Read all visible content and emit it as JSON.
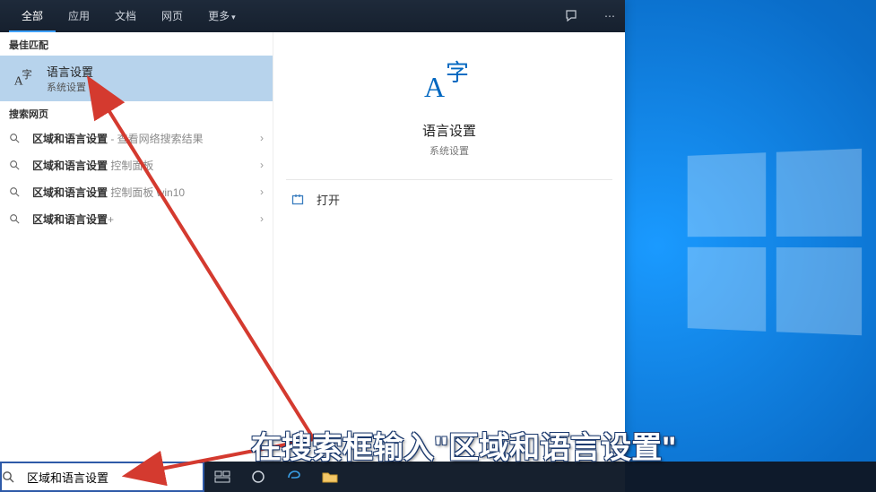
{
  "tabs": {
    "all": "全部",
    "apps": "应用",
    "docs": "文档",
    "web": "网页",
    "more": "更多"
  },
  "sections": {
    "best_match": "最佳匹配",
    "web_search": "搜索网页"
  },
  "best_match": {
    "title": "语言设置",
    "subtitle": "系统设置"
  },
  "web_results": [
    {
      "prefix": "区域和语言设置",
      "suffix": " - 查看网络搜索结果",
      "has_chevron": true
    },
    {
      "prefix": "区域和语言设置",
      "suffix": " 控制面板",
      "has_chevron": true
    },
    {
      "prefix": "区域和语言设置",
      "suffix": " 控制面板 win10",
      "has_chevron": true
    },
    {
      "prefix": "区域和语言设置",
      "suffix": "+",
      "has_chevron": true
    }
  ],
  "preview": {
    "title": "语言设置",
    "subtitle": "系统设置",
    "open_label": "打开"
  },
  "search": {
    "query": "区域和语言设置"
  },
  "caption": "在搜索框输入\"区域和语言设置\""
}
